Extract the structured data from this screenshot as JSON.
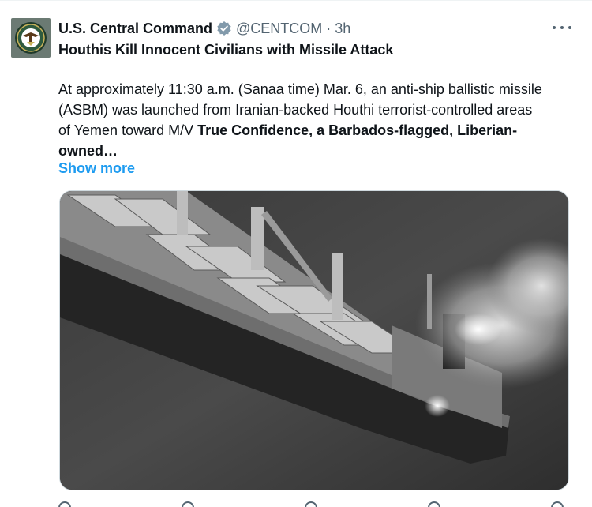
{
  "account": {
    "name": "U.S. Central Command",
    "handle": "@CENTCOM",
    "separator": "·",
    "time": "3h",
    "avatar_icon": "centcom-seal-icon",
    "verified_icon": "verified-badge-icon"
  },
  "tweet": {
    "headline": "Houthis Kill Innocent Civilians with Missile Attack",
    "body_regular": "At approximately 11:30 a.m. (Sanaa time) Mar. 6, an anti-ship ballistic missile (ASBM) was launched from Iranian-backed Houthi terrorist-controlled areas of Yemen toward M/V ",
    "body_bold": "True Confidence, a Barbados-flagged, Liberian-owned…",
    "show_more": "Show more"
  },
  "media": {
    "description_icon": "ship-photo-image"
  },
  "colors": {
    "link": "#1d9bf0",
    "secondary_text": "#536471",
    "primary_text": "#0f1419"
  }
}
